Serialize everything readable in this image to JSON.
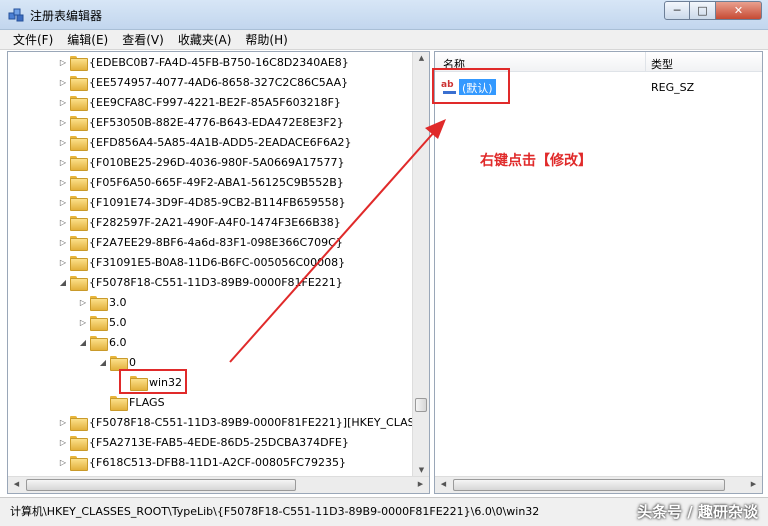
{
  "window": {
    "title": "注册表编辑器",
    "controls": {
      "minimize": "─",
      "maximize": "□",
      "close": "✕"
    }
  },
  "menu": [
    "文件(F)",
    "编辑(E)",
    "查看(V)",
    "收藏夹(A)",
    "帮助(H)"
  ],
  "tree": {
    "nodes": [
      {
        "label": "{EDEBC0B7-FA4D-45FB-B750-16C8D2340AE8}",
        "expander": "▷"
      },
      {
        "label": "{EE574957-4077-4AD6-8658-327C2C86C5AA}",
        "expander": "▷"
      },
      {
        "label": "{EE9CFA8C-F997-4221-BE2F-85A5F603218F}",
        "expander": "▷"
      },
      {
        "label": "{EF53050B-882E-4776-B643-EDA472E8E3F2}",
        "expander": "▷"
      },
      {
        "label": "{EFD856A4-5A85-4A1B-ADD5-2EADACE6F6A2}",
        "expander": "▷"
      },
      {
        "label": "{F010BE25-296D-4036-980F-5A0669A17577}",
        "expander": "▷"
      },
      {
        "label": "{F05F6A50-665F-49F2-ABA1-56125C9B552B}",
        "expander": "▷"
      },
      {
        "label": "{F1091E74-3D9F-4D85-9CB2-B114FB659558}",
        "expander": "▷"
      },
      {
        "label": "{F282597F-2A21-490F-A4F0-1474F3E66B38}",
        "expander": "▷"
      },
      {
        "label": "{F2A7EE29-8BF6-4a6d-83F1-098E366C709C}",
        "expander": "▷"
      },
      {
        "label": "{F31091E5-B0A8-11D6-B6FC-005056C00008}",
        "expander": "▷"
      },
      {
        "label": "{F5078F18-C551-11D3-89B9-0000F81FE221}",
        "expander": "◢"
      },
      {
        "label": "3.0",
        "expander": "▷"
      },
      {
        "label": "5.0",
        "expander": "▷"
      },
      {
        "label": "6.0",
        "expander": "◢"
      },
      {
        "label": "0",
        "expander": "◢"
      },
      {
        "label": "win32",
        "expander": ""
      },
      {
        "label": "FLAGS",
        "expander": ""
      },
      {
        "label": "{F5078F18-C551-11D3-89B9-0000F81FE221}][HKEY_CLAS",
        "expander": "▷"
      },
      {
        "label": "{F5A2713E-FAB5-4EDE-86D5-25DCBA374DFE}",
        "expander": "▷"
      },
      {
        "label": "{F618C513-DFB8-11D1-A2CF-00805FC79235}",
        "expander": "▷"
      }
    ]
  },
  "list": {
    "columns": {
      "name": "名称",
      "type": "类型"
    },
    "values": [
      {
        "name": "(默认)",
        "type": "REG_SZ",
        "icon": "ab-string-icon"
      }
    ]
  },
  "annotation": {
    "text": "右键点击【修改】",
    "color": "#e02a2a"
  },
  "status": {
    "path": "计算机\\HKEY_CLASSES_ROOT\\TypeLib\\{F5078F18-C551-11D3-89B9-0000F81FE221}\\6.0\\0\\win32"
  },
  "watermark": "头条号 / 趣研杂谈",
  "colors": {
    "selection": "#3399ff",
    "annotation": "#e02a2a"
  }
}
